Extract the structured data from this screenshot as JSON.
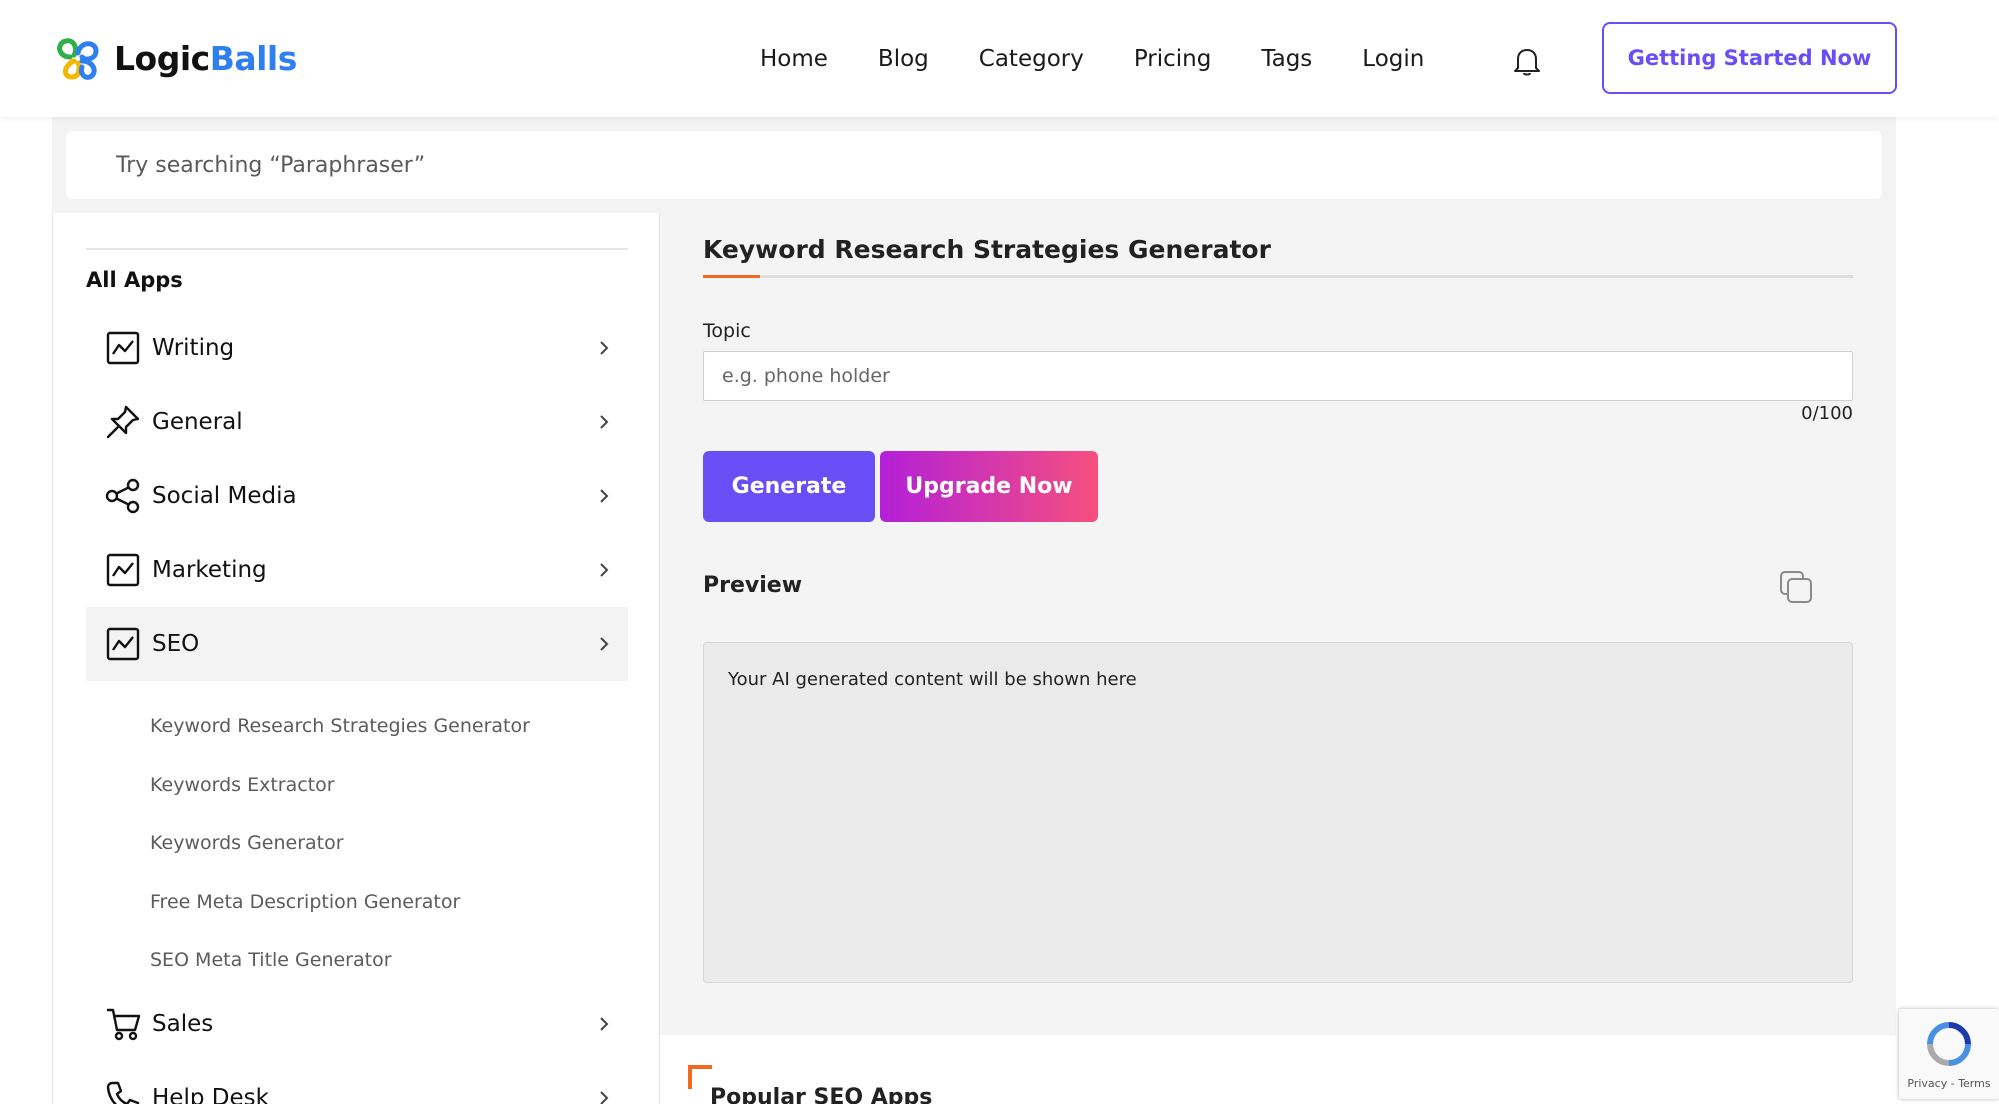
{
  "brand": {
    "name_part1": "Logic",
    "name_part2": "Balls"
  },
  "nav": {
    "items": [
      "Home",
      "Blog",
      "Category",
      "Pricing",
      "Tags",
      "Login"
    ],
    "cta_label": "Getting Started Now"
  },
  "search": {
    "placeholder": "Try searching “Paraphraser”"
  },
  "sidebar": {
    "heading": "All Apps",
    "categories": [
      {
        "label": "Writing",
        "icon": "chart-line-icon"
      },
      {
        "label": "General",
        "icon": "pin-icon"
      },
      {
        "label": "Social Media",
        "icon": "share-icon"
      },
      {
        "label": "Marketing",
        "icon": "chart-line-icon"
      },
      {
        "label": "SEO",
        "icon": "chart-line-icon",
        "active": true
      },
      {
        "label": "Sales",
        "icon": "cart-icon"
      },
      {
        "label": "Help Desk",
        "icon": "phone-icon"
      }
    ],
    "seo_apps": [
      "Keyword Research Strategies Generator",
      "Keywords Extractor",
      "Keywords Generator",
      "Free Meta Description Generator",
      "SEO Meta Title Generator"
    ]
  },
  "tool": {
    "title": "Keyword Research Strategies Generator",
    "topic_label": "Topic",
    "topic_placeholder": "e.g. phone holder",
    "topic_value": "",
    "counter": "0/100",
    "generate_label": "Generate",
    "upgrade_label": "Upgrade Now",
    "preview_label": "Preview",
    "preview_placeholder": "Your AI generated content will be shown here"
  },
  "popular": {
    "heading": "Popular SEO Apps"
  },
  "recaptcha": {
    "privacy": "Privacy",
    "separator": " - ",
    "terms": "Terms"
  },
  "colors": {
    "accent": "#6a4ef5",
    "brand_blue": "#2f7ff0",
    "orange": "#f26a21",
    "upgrade_start": "#b320d8",
    "upgrade_end": "#f64f7f"
  }
}
